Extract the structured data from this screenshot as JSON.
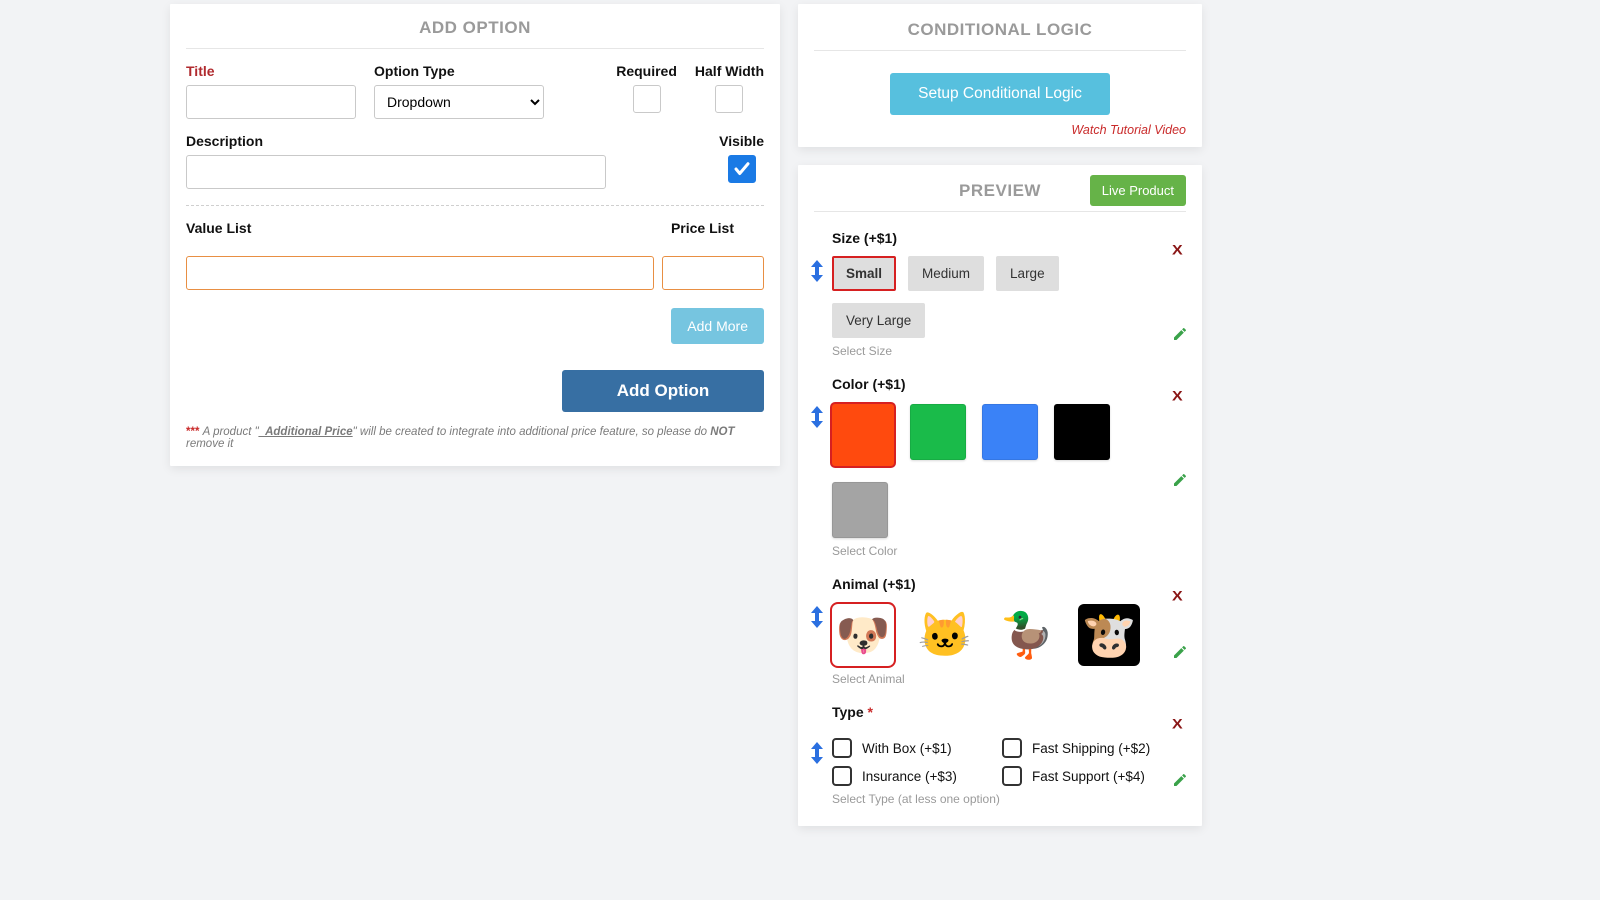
{
  "addOption": {
    "title": "ADD OPTION",
    "fields": {
      "title_label": "Title",
      "option_type_label": "Option Type",
      "option_type_value": "Dropdown",
      "required_label": "Required",
      "half_width_label": "Half Width",
      "description_label": "Description",
      "visible_label": "Visible",
      "value_list_label": "Value List",
      "price_list_label": "Price List"
    },
    "buttons": {
      "add_more": "Add More",
      "add_option": "Add Option"
    },
    "footnote": {
      "stars": "*** ",
      "pre": "A product \"",
      "u": "_Additional Price",
      "mid": "\" will be created to integrate into additional price feature, so please do ",
      "not": "NOT",
      "post": " remove it"
    }
  },
  "cond": {
    "title": "CONDITIONAL LOGIC",
    "button": "Setup Conditional Logic",
    "tutorial": "Watch Tutorial Video"
  },
  "preview": {
    "title": "PREVIEW",
    "live": "Live Product",
    "size": {
      "label": "Size (+$1)",
      "options": [
        "Small",
        "Medium",
        "Large",
        "Very Large"
      ],
      "hint": "Select Size"
    },
    "color": {
      "label": "Color (+$1)",
      "colors": [
        "#ff4a0e",
        "#1abb4a",
        "#3a82f7",
        "#000000",
        "#a4a4a4"
      ],
      "hint": "Select Color"
    },
    "animal": {
      "label": "Animal (+$1)",
      "emojis": [
        "🐶",
        "🐱",
        "🦆",
        "🐮"
      ],
      "hint": "Select Animal"
    },
    "type": {
      "label": "Type ",
      "options": [
        "With Box (+$1)",
        "Fast Shipping (+$2)",
        "Insurance (+$3)",
        "Fast Support (+$4)"
      ],
      "hint": "Select Type (at less one option)"
    }
  }
}
